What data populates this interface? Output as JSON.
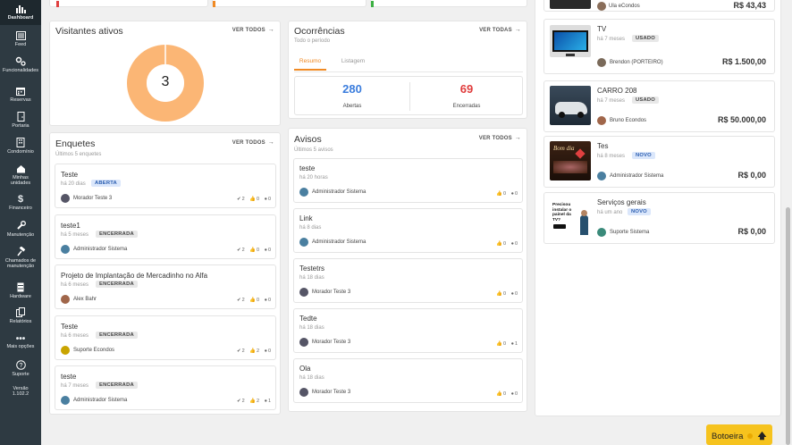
{
  "sidebar": {
    "items": [
      {
        "label": "Dashboard",
        "icon": "chart-icon"
      },
      {
        "label": "Feed",
        "icon": "newspaper-icon"
      },
      {
        "label": "Funcionalidades",
        "icon": "cogs-icon"
      },
      {
        "label": "Reservas",
        "icon": "calendar-icon"
      },
      {
        "label": "Portaria",
        "icon": "door-icon"
      },
      {
        "label": "Condomínio",
        "icon": "building-icon"
      },
      {
        "label": "Minhas unidades",
        "icon": "home-icon"
      },
      {
        "label": "Financeiro",
        "icon": "dollar-icon"
      },
      {
        "label": "Manutenção",
        "icon": "wrench-icon"
      },
      {
        "label": "Chamados de manutenção",
        "icon": "hammer-icon"
      },
      {
        "label": "Hardware",
        "icon": "server-icon"
      },
      {
        "label": "Relatórios",
        "icon": "copy-icon"
      },
      {
        "label": "Mais opções",
        "icon": "ellipsis-icon"
      },
      {
        "label": "Suporte",
        "icon": "question-icon"
      }
    ],
    "version_label": "Versão",
    "version": "1.102.2"
  },
  "visitantes": {
    "title": "Visitantes ativos",
    "ver_todos": "VER TODOS",
    "count": "3",
    "color": "#fbb675"
  },
  "ocorrencias": {
    "title": "Ocorrências",
    "subtitle": "Todo o período",
    "ver_todas": "VER TODAS",
    "tabs": [
      "Resumo",
      "Listagem"
    ],
    "abertas": {
      "value": "280",
      "label": "Abertas",
      "color": "#3b7ddd"
    },
    "encerradas": {
      "value": "69",
      "label": "Encerradas",
      "color": "#e03c3c"
    }
  },
  "enquetes": {
    "title": "Enquetes",
    "subtitle": "Últimos 5 enquetes",
    "ver_todos": "VER TODOS",
    "items": [
      {
        "title": "Teste",
        "time": "há 20 dias",
        "badge": "ABERTA",
        "user": "Morador Teste 3",
        "s1": "2",
        "s2": "0",
        "s3": "0"
      },
      {
        "title": "teste1",
        "time": "há 5 meses",
        "badge": "ENCERRADA",
        "user": "Administrador Sistema",
        "s1": "2",
        "s2": "0",
        "s3": "0"
      },
      {
        "title": "Projeto de Implantação de Mercadinho no Alfa",
        "time": "há 6 meses",
        "badge": "ENCERRADA",
        "user": "Alex Bahr",
        "s1": "2",
        "s2": "0",
        "s3": "0"
      },
      {
        "title": "Teste",
        "time": "há 6 meses",
        "badge": "ENCERRADA",
        "user": "Suporte Econdos",
        "s1": "2",
        "s2": "2",
        "s3": "0"
      },
      {
        "title": "teste",
        "time": "há 7 meses",
        "badge": "ENCERRADA",
        "user": "Administrador Sistema",
        "s1": "2",
        "s2": "2",
        "s3": "1"
      }
    ]
  },
  "avisos": {
    "title": "Avisos",
    "subtitle": "Últimos 5 avisos",
    "ver_todos": "VER TODOS",
    "items": [
      {
        "title": "teste",
        "time": "há 20 horas",
        "user": "Administrador Sistema",
        "likes": "0",
        "comments": "0"
      },
      {
        "title": "Link",
        "time": "há 8 dias",
        "user": "Administrador Sistema",
        "likes": "0",
        "comments": "0"
      },
      {
        "title": "Testetrs",
        "time": "há 18 dias",
        "user": "Morador Teste 3",
        "likes": "0",
        "comments": "0"
      },
      {
        "title": "Tedte",
        "time": "há 18 dias",
        "user": "Morador Teste 3",
        "likes": "0",
        "comments": "1"
      },
      {
        "title": "Ola",
        "time": "há 18 dias",
        "user": "Morador Teste 3",
        "likes": "0",
        "comments": "0"
      }
    ]
  },
  "marketplace": {
    "top": {
      "user": "Ula eCondos",
      "price": "R$ 43,43"
    },
    "items": [
      {
        "title": "TV",
        "time": "há 7 meses",
        "badge": "USADO",
        "user": "Brendon (PORTEIRO)",
        "price": "R$ 1.500,00",
        "thumb": "tv"
      },
      {
        "title": "CARRO 208",
        "time": "há 7 meses",
        "badge": "USADO",
        "user": "Bruno Econdos",
        "price": "R$ 50.000,00",
        "thumb": "car"
      },
      {
        "title": "Tes",
        "time": "há 8 meses",
        "badge": "NOVO",
        "user": "Administrador Sistema",
        "price": "R$ 0,00",
        "thumb": "night",
        "thumb_text": "Bom dia"
      },
      {
        "title": "Serviços gerais",
        "time": "há um ano",
        "badge": "NOVO",
        "user": "Suporte Sistema",
        "price": "R$ 0,00",
        "thumb": "ad",
        "thumb_text": "Precisou instalar o painel da TV?"
      }
    ]
  },
  "botoeira": {
    "label": "Botoeira"
  }
}
